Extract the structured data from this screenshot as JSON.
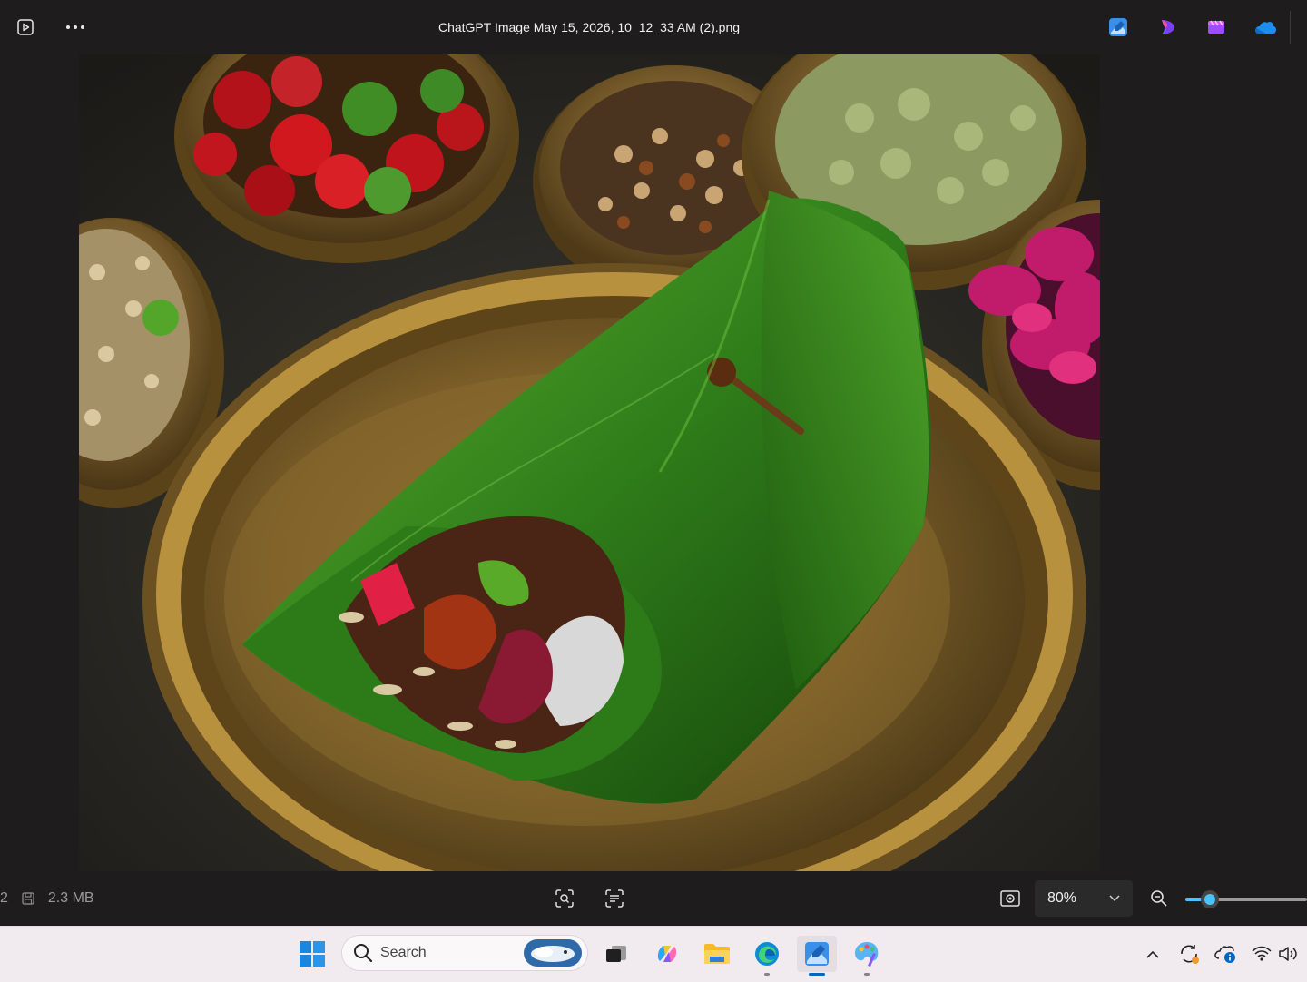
{
  "titlebar": {
    "title": "ChatGPT Image May 15, 2026, 10_12_33 AM (2).png",
    "icons": [
      "slideshow-icon",
      "more-icon",
      "photos-edit-icon",
      "clipchamp-icon",
      "designer-icon",
      "onedrive-icon"
    ]
  },
  "photo": {
    "description_icon": "photo-image"
  },
  "bottombar": {
    "index_fragment": "2",
    "file_size": "2.3 MB",
    "zoom_value": "80%",
    "zoom_level": 0.2
  },
  "taskbar": {
    "search_label": "Search",
    "accent": "#0067c0"
  }
}
